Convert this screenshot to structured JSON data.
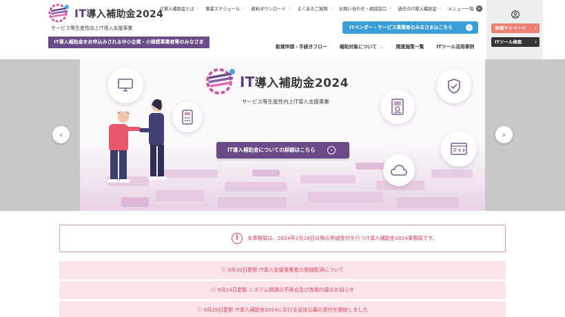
{
  "header": {
    "logo_it": "IT",
    "logo_title": "導入補助金2024",
    "logo_subtitle": "サービス等生産性向上IT導入支援事業",
    "target_banner": "IT導入補助金をお申込みされる中小企業・小規模事業者等のみなさま",
    "top_nav": [
      {
        "label": "IT導入補助金とは"
      },
      {
        "label": "事業スケジュール"
      },
      {
        "label": "資料ダウンロード"
      },
      {
        "label": "よくあるご質問"
      },
      {
        "label": "お問い合わせ・相談窓口"
      },
      {
        "label": "過去のIT導入補助金"
      }
    ],
    "menu_label": "メニュー一覧",
    "menu_icon_glyph": "≡",
    "vendor_button": "ITベンダー・サービス事業者のみなさまはこちら",
    "main_nav": [
      {
        "label": "新規申請・手続きフロー"
      },
      {
        "label": "補助対象について"
      },
      {
        "label": "関連施策一覧"
      },
      {
        "label": "ITツール活用事例"
      }
    ],
    "mypage_button": "申請マイページ",
    "tool_search_button": "ITツール検索"
  },
  "hero": {
    "title_it": "IT",
    "title": "導入補助金2024",
    "subtitle": "サービス等生産性向上IT導入支援事業",
    "cta": "IT導入補助金についての詳細はこちら"
  },
  "notices": {
    "alert": "本事務局は、2024年2月16日以降の申請受付を行うIT導入補助金2024事務局です。",
    "items": [
      {
        "text": "ⓘ 9月30日更新 IT導入支援事業者の登録取消について"
      },
      {
        "text": "ⓘ 9月24日更新 システム関連の不具合及び改修内容のお知らせ"
      },
      {
        "text": "ⓘ 9月20日更新 IT導入補助金2024における追加公募の受付を開始しました"
      }
    ]
  },
  "colors": {
    "brand_purple": "#6a4a87",
    "vendor_blue": "#3a9fd8",
    "mypage_coral": "#f07f73",
    "alert_red": "#e0405a",
    "notice_bg": "#fbe4e8"
  },
  "icons": [
    "logo-mark",
    "chevron-right-icon",
    "menu-icon",
    "user-icon",
    "monitor-icon",
    "calculator-icon",
    "shield-check-icon",
    "certificate-icon",
    "code-window-icon",
    "cloud-icon",
    "chevron-left-icon",
    "warning-icon"
  ]
}
